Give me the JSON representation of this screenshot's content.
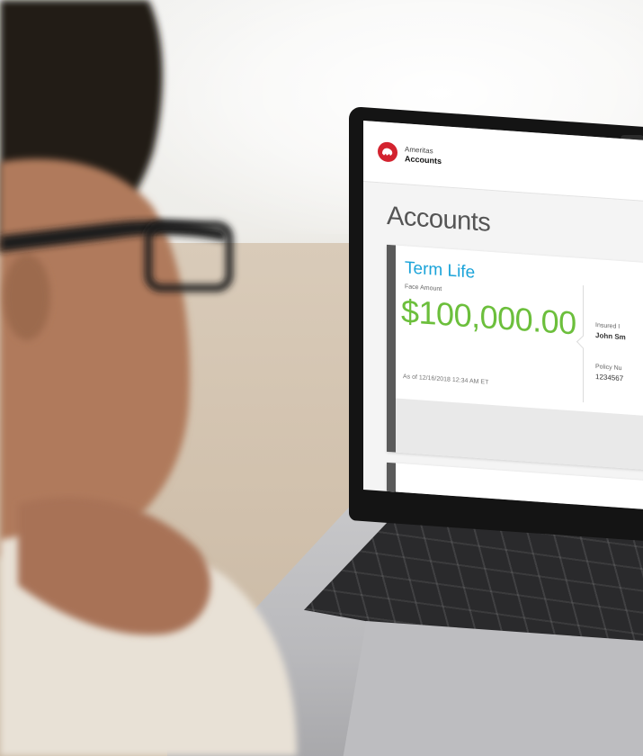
{
  "app": {
    "brand_top": "Ameritas",
    "brand_bottom": "Accounts",
    "page_title": "Accounts"
  },
  "account_card": {
    "product_name": "Term Life",
    "face_amount_label": "Face Amount",
    "face_amount_value": "$100,000.00",
    "as_of": "As of 12/16/2018 12:34 AM ET",
    "insured_label": "Insured I",
    "insured_name": "John Sm",
    "policy_label": "Policy Nu",
    "policy_number": "1234567"
  },
  "colors": {
    "brand_red": "#d3232f",
    "product_blue": "#1aa3d9",
    "amount_green": "#6cbf3c"
  },
  "icons": {
    "logo": "bison-logo-icon"
  }
}
